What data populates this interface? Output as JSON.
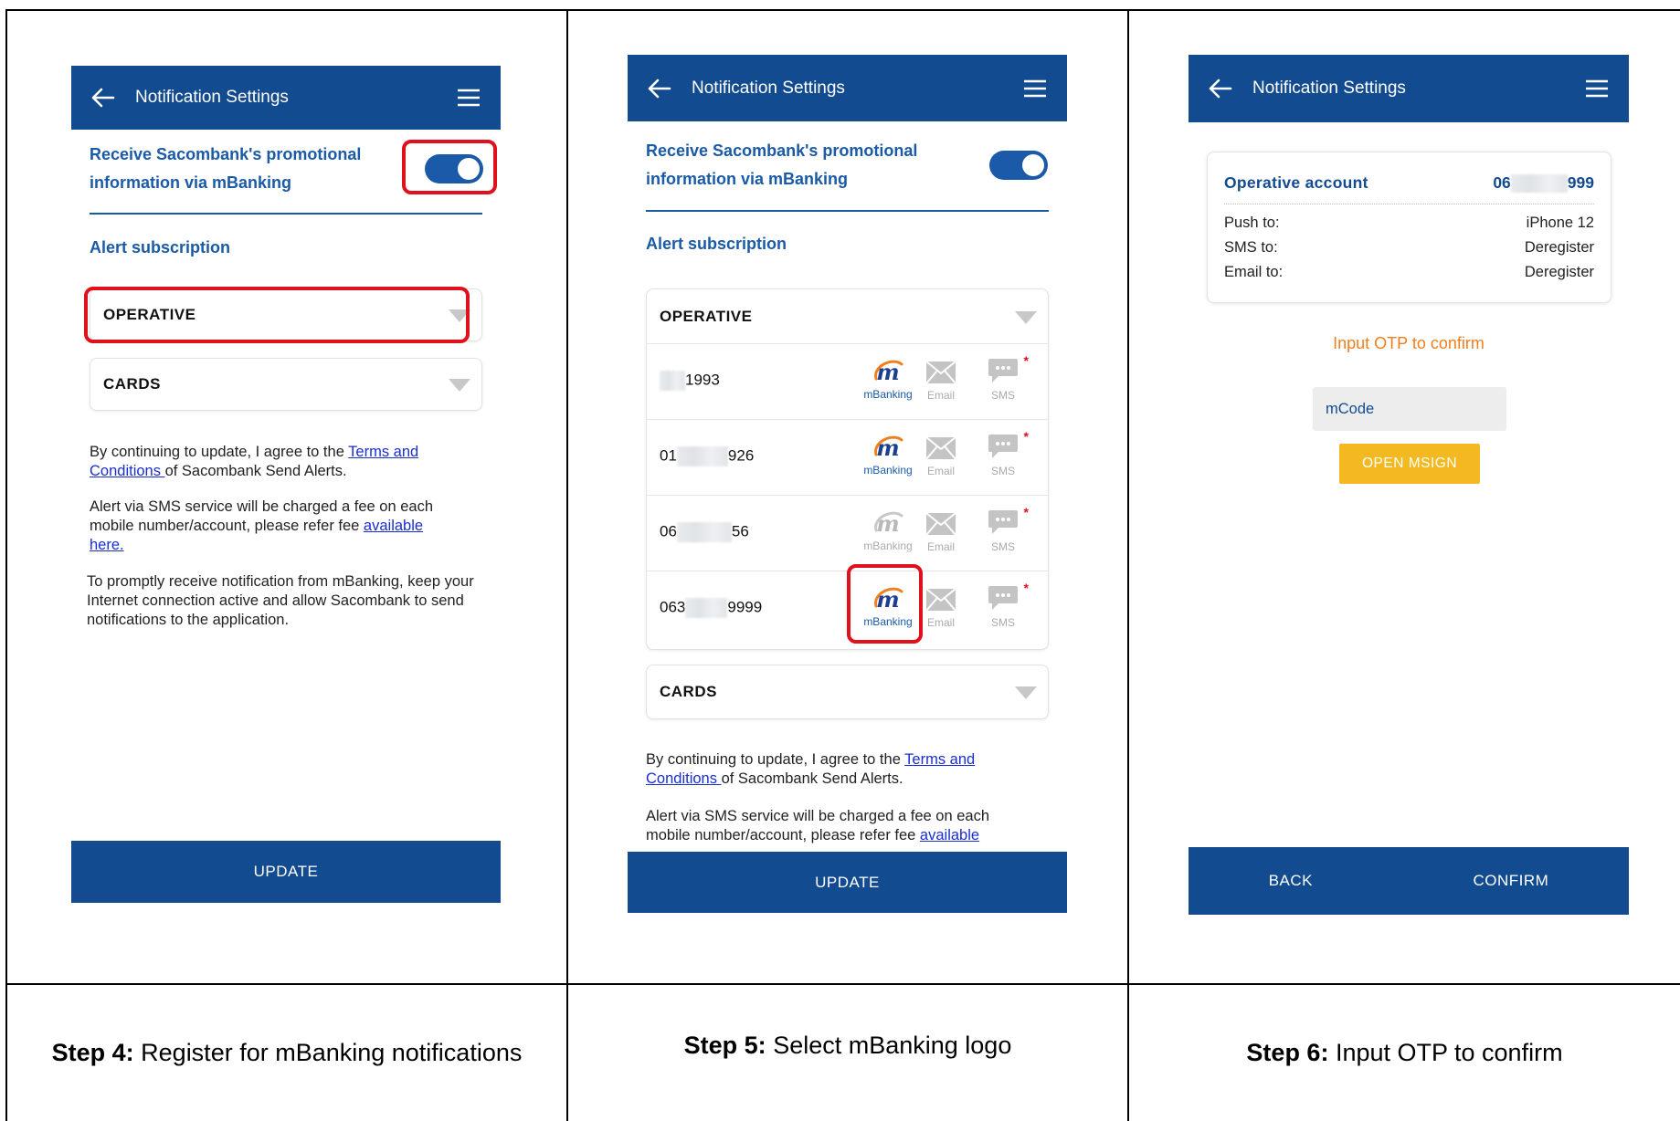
{
  "panels": [
    {
      "appbar_title": "Notification Settings",
      "promo_line1": "Receive Sacombank's promotional",
      "promo_line2": "information via mBanking",
      "alert_title": "Alert subscription",
      "dropdowns": [
        "OPERATIVE",
        "CARDS"
      ],
      "terms_pre": "By continuing to update, I agree to the ",
      "terms_link1": "Terms and",
      "terms_link2": "Conditions ",
      "terms_post": "of Sacombank Send Alerts.",
      "fee_text": "Alert via SMS service will be charged a fee on each mobile number/account, please refer fee ",
      "fee_link": "available",
      "fee_link2": "here.",
      "prompt_text": "To promptly receive notification from mBanking, keep your Internet connection active and allow Sacombank to send notifications to the application.",
      "button": "UPDATE"
    },
    {
      "appbar_title": "Notification Settings",
      "promo_line1": "Receive Sacombank's promotional",
      "promo_line2": "information via mBanking",
      "alert_title": "Alert subscription",
      "dropdown_open": "OPERATIVE",
      "accounts": [
        {
          "prefix": "",
          "suffix": "1993",
          "mbanking_active": true
        },
        {
          "prefix": "01",
          "suffix": "926",
          "mbanking_active": true
        },
        {
          "prefix": "06",
          "suffix": "56",
          "mbanking_active": false
        },
        {
          "prefix": "063",
          "suffix": "9999",
          "mbanking_active": true
        }
      ],
      "channel_labels": {
        "mbanking": "mBanking",
        "email": "Email",
        "sms": "SMS"
      },
      "dropdown_closed": "CARDS",
      "terms_pre": "By continuing to update, I agree to the ",
      "terms_link1": "Terms and",
      "terms_link2": "Conditions ",
      "terms_post": "of Sacombank Send Alerts.",
      "fee_line1": "Alert via SMS service will be charged a fee on each",
      "fee_line2_pre": "mobile number/account, please refer fee ",
      "fee_link": "available",
      "button": "UPDATE"
    },
    {
      "appbar_title": "Notification Settings",
      "card_title": "Operative account",
      "card_acct_prefix": "06",
      "card_acct_suffix": "999",
      "rows": [
        {
          "k": "Push to:",
          "v": "iPhone 12"
        },
        {
          "k": "SMS to:",
          "v": "Deregister"
        },
        {
          "k": "Email to:",
          "v": "Deregister"
        }
      ],
      "otp_text": "Input OTP to confirm",
      "mcode_placeholder": "mCode",
      "msign_button": "OPEN MSIGN",
      "back_button": "BACK",
      "confirm_button": "CONFIRM"
    }
  ],
  "captions": [
    {
      "step": "Step 4:",
      "text": " Register for mBanking notifications"
    },
    {
      "step": "Step 5:",
      "text": " Select mBanking logo"
    },
    {
      "step": "Step 6:",
      "text": " Input OTP to confirm"
    }
  ],
  "colors": {
    "appbar": "#124b8f",
    "link": "#1a5aa6",
    "highlight": "#e0101c",
    "otp": "#f07f1e",
    "msign": "#f4b921"
  }
}
